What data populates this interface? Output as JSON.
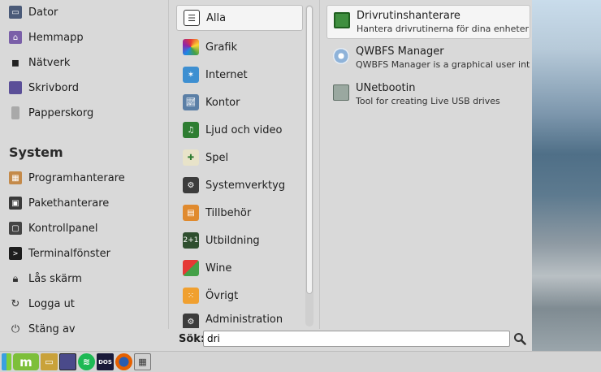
{
  "places": [
    {
      "label": "Dator",
      "icon": "computer-icon"
    },
    {
      "label": "Hemmapp",
      "icon": "home-folder-icon"
    },
    {
      "label": "Nätverk",
      "icon": "network-icon"
    },
    {
      "label": "Skrivbord",
      "icon": "desktop-icon"
    },
    {
      "label": "Papperskorg",
      "icon": "trash-icon"
    }
  ],
  "system": {
    "title": "System",
    "items": [
      {
        "label": "Programhanterare",
        "icon": "software-manager-icon"
      },
      {
        "label": "Pakethanterare",
        "icon": "package-manager-icon"
      },
      {
        "label": "Kontrollpanel",
        "icon": "control-panel-icon"
      },
      {
        "label": "Terminalfönster",
        "icon": "terminal-icon"
      },
      {
        "label": "Lås skärm",
        "icon": "lock-icon"
      },
      {
        "label": "Logga ut",
        "icon": "logout-icon"
      },
      {
        "label": "Stäng av",
        "icon": "power-icon"
      }
    ]
  },
  "categories": [
    {
      "label": "Alla",
      "icon": "all-apps-icon"
    },
    {
      "label": "Grafik",
      "icon": "graphics-icon"
    },
    {
      "label": "Internet",
      "icon": "internet-icon"
    },
    {
      "label": "Kontor",
      "icon": "office-icon"
    },
    {
      "label": "Ljud och video",
      "icon": "multimedia-icon"
    },
    {
      "label": "Spel",
      "icon": "games-icon"
    },
    {
      "label": "Systemverktyg",
      "icon": "system-tools-icon"
    },
    {
      "label": "Tillbehör",
      "icon": "accessories-icon"
    },
    {
      "label": "Utbildning",
      "icon": "education-icon"
    },
    {
      "label": "Wine",
      "icon": "wine-icon"
    },
    {
      "label": "Övrigt",
      "icon": "other-icon"
    },
    {
      "label": "Administration",
      "icon": "administration-icon"
    }
  ],
  "selected_category": "Alla",
  "apps": [
    {
      "name": "Drivrutinshanterare",
      "desc": "Hantera drivrutinerna för dina enheter",
      "icon": "driver-manager-icon"
    },
    {
      "name": "QWBFS Manager",
      "desc": "QWBFS Manager is a graphical user interf…",
      "icon": "qwbfs-icon"
    },
    {
      "name": "UNetbootin",
      "desc": "Tool for creating Live USB drives",
      "icon": "unetbootin-icon"
    }
  ],
  "search": {
    "label": "Sök:",
    "value": "dri"
  },
  "panel": [
    {
      "name": "show-desktop-icon"
    },
    {
      "name": "mint-menu-icon"
    },
    {
      "name": "file-manager-icon"
    },
    {
      "name": "window-icon"
    },
    {
      "name": "spotify-icon"
    },
    {
      "name": "dosbox-icon"
    },
    {
      "name": "firefox-icon"
    },
    {
      "name": "calculator-icon"
    }
  ],
  "colors": {
    "accent": "#7dbf3a",
    "selected_bg": "#f4f4f4",
    "menu_bg": "#d7d7d7"
  }
}
